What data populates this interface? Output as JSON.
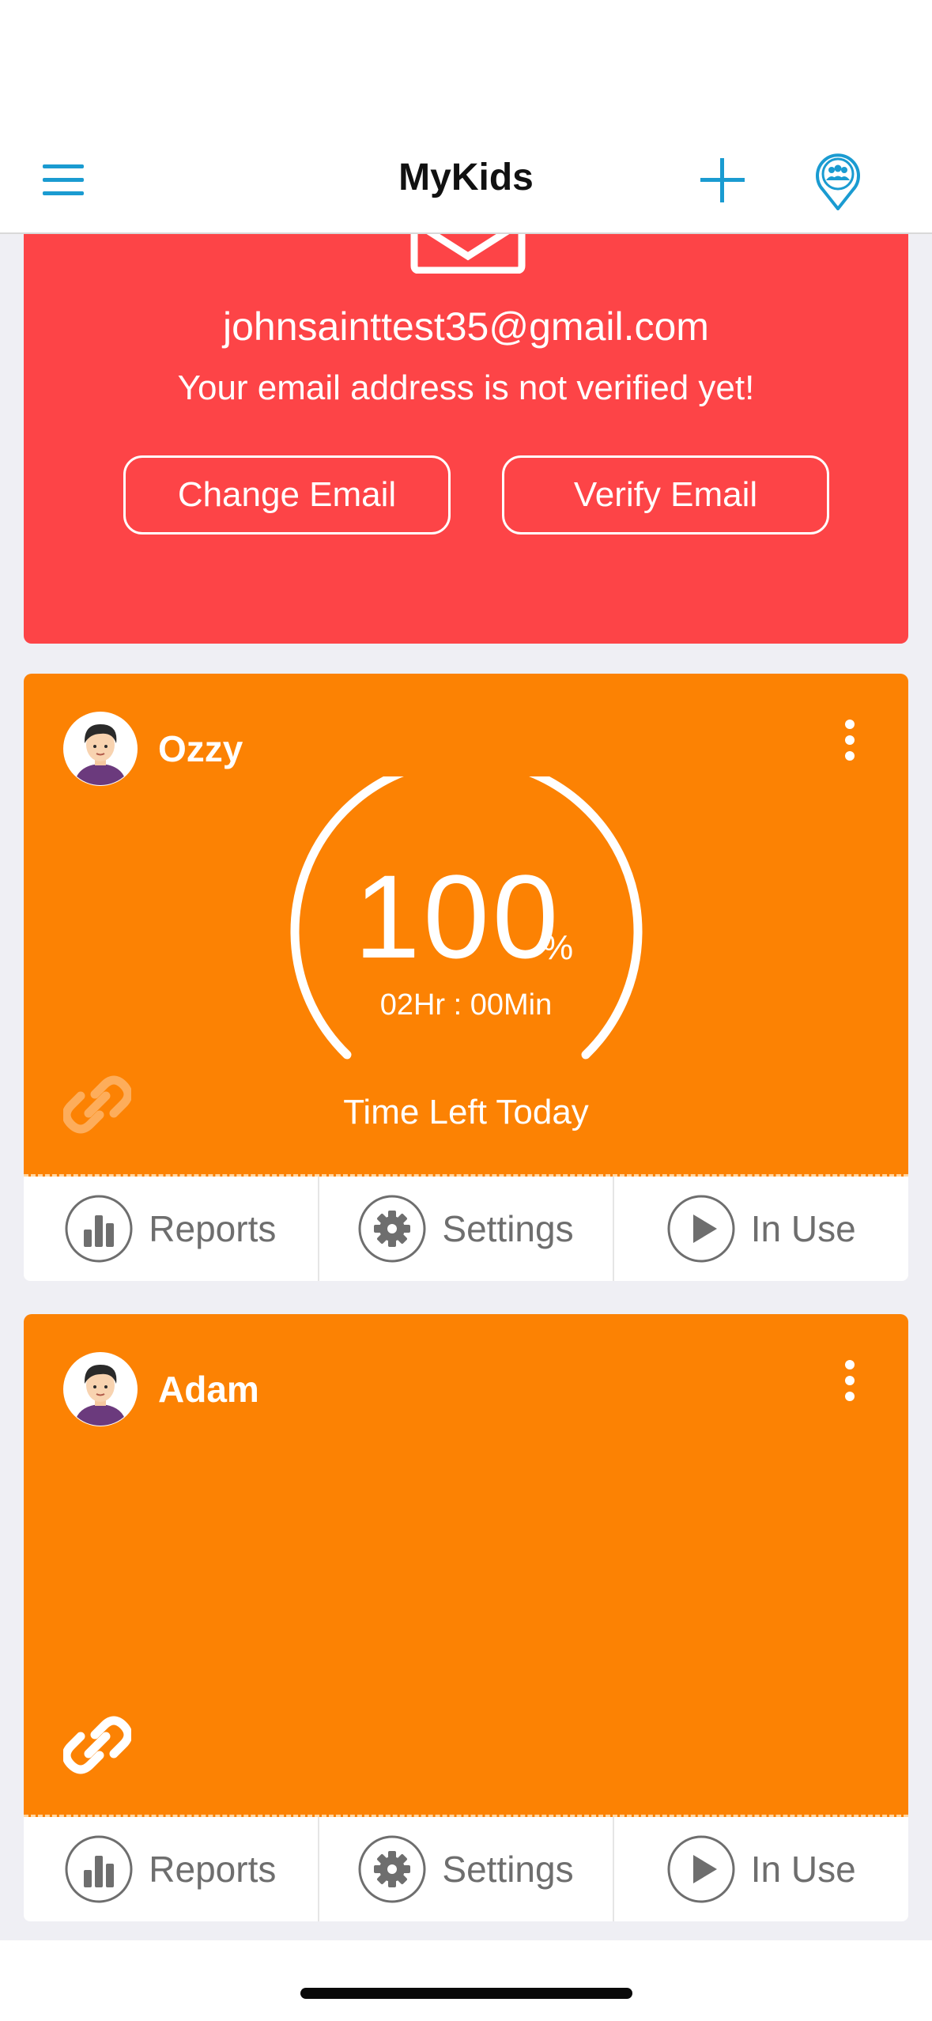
{
  "nav": {
    "title": "MyKids",
    "left_icon": "menu-icon",
    "right_icons": [
      "plus-icon",
      "family-location-icon"
    ],
    "accent_color": "#1a9bd1"
  },
  "email_banner": {
    "icon": "envelope-icon",
    "email": "johnsainttest35@gmail.com",
    "message": "Your email address is not verified yet!",
    "change_label": "Change Email",
    "verify_label": "Verify Email",
    "color": "#fd4447"
  },
  "kids": [
    {
      "name": "Ozzy",
      "percent": "100",
      "percent_symbol": "%",
      "time_left": "02Hr : 00Min",
      "caption": "Time Left Today",
      "link_icon": "link-icon",
      "actions": {
        "reports": "Reports",
        "settings": "Settings",
        "status": "In Use"
      }
    },
    {
      "name": "Adam",
      "link_icon": "link-icon",
      "actions": {
        "reports": "Reports",
        "settings": "Settings",
        "status": "In Use"
      }
    }
  ],
  "card_color": "#fc8203"
}
